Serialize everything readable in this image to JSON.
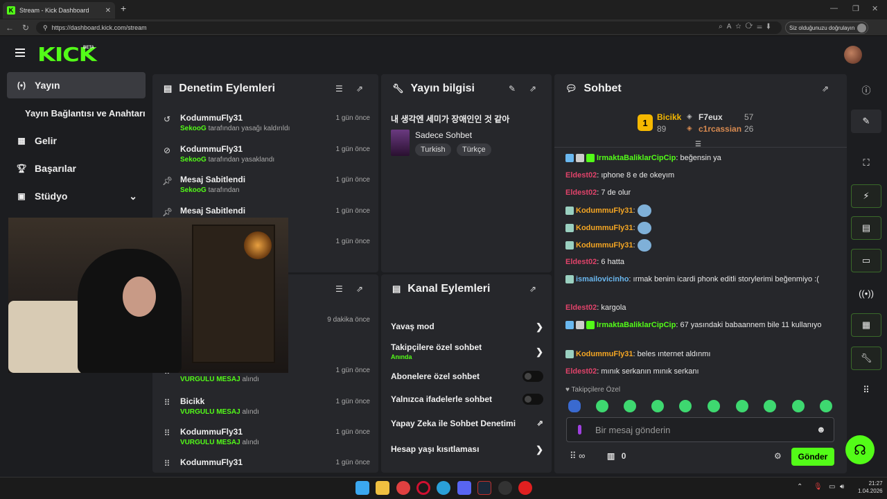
{
  "browser": {
    "tab_title": "Stream - Kick Dashboard",
    "url": "https://dashboard.kick.com/stream",
    "verify_label": "Siz olduğunuzu doğrulayın"
  },
  "app": {
    "logo": "KICK",
    "beta": "BETA"
  },
  "sidebar": {
    "items": [
      {
        "label": "Yayın",
        "icon": "broadcast-icon"
      },
      {
        "label": "Yayın Bağlantısı ve Anahtarı"
      },
      {
        "label": "Gelir",
        "icon": "revenue-icon"
      },
      {
        "label": "Başarılar",
        "icon": "trophy-icon"
      },
      {
        "label": "Stüdyo",
        "icon": "studio-icon"
      }
    ]
  },
  "moderation": {
    "title": "Denetim Eylemleri",
    "actions": [
      {
        "title": "KodummuFly31",
        "user": "SekooG",
        "desc": "tarafından yasağı kaldırıldı",
        "time": "1 gün önce",
        "icon": "unban-icon"
      },
      {
        "title": "KodummuFly31",
        "user": "SekooG",
        "desc": "tarafından yasaklandı",
        "time": "1 gün önce",
        "icon": "ban-icon"
      },
      {
        "title": "Mesaj Sabitlendi",
        "user": "SekooG",
        "desc": "tarafından",
        "time": "1 gün önce",
        "icon": "pin-icon"
      },
      {
        "title": "Mesaj Sabitlendi",
        "user": "",
        "desc": "",
        "time": "1 gün önce",
        "icon": "pin-icon"
      },
      {
        "title": "",
        "user": "",
        "desc": "",
        "time": "1 gün önce",
        "icon": ""
      }
    ]
  },
  "activity": {
    "items": [
      {
        "title": "",
        "user": "",
        "desc": "",
        "time": "9 dakika önce"
      },
      {
        "title": "",
        "user": "VURGULU MESAJ",
        "desc": "alındı",
        "time": "1 gün önce"
      },
      {
        "title": "Bicikk",
        "user": "VURGULU MESAJ",
        "desc": "alındı",
        "time": "1 gün önce"
      },
      {
        "title": "KodummuFly31",
        "user": "VURGULU MESAJ",
        "desc": "alındı",
        "time": "1 gün önce"
      },
      {
        "title": "KodummuFly31",
        "user": "",
        "desc": "",
        "time": "1 gün önce"
      }
    ]
  },
  "stream_info": {
    "title": "Yayın bilgisi",
    "stream_title": "내 생각엔 세미가 장애인인 것 같아",
    "category": "Sadece Sohbet",
    "tags": [
      "Turkish",
      "Türkçe"
    ]
  },
  "channel_actions": {
    "title": "Kanal Eylemleri",
    "items": [
      {
        "label": "Yavaş mod",
        "type": "chevron"
      },
      {
        "label": "Takipçilere özel sohbet",
        "sub": "Anında",
        "type": "chevron"
      },
      {
        "label": "Abonelere özel sohbet",
        "type": "toggle",
        "value": "off"
      },
      {
        "label": "Yalnızca ifadelerle sohbet",
        "type": "toggle",
        "value": "off"
      },
      {
        "label": "Yapay Zeka ile Sohbet Denetimi",
        "type": "external"
      },
      {
        "label": "Hesap yaşı kısıtlaması",
        "type": "chevron"
      }
    ]
  },
  "chat": {
    "title": "Sohbet",
    "leaderboard": [
      {
        "rank": "1",
        "name": "Bicikk",
        "value": "89"
      },
      {
        "rank": "2",
        "name": "F7eux",
        "value": "57"
      },
      {
        "rank": "3",
        "name": "c1rcassian",
        "value": "26"
      }
    ],
    "messages": [
      {
        "user": "IrmaktaBaliklarCipCip",
        "color": "#53fc18",
        "text": "beğensin ya"
      },
      {
        "user": "Eldest02",
        "color": "#e0436a",
        "text": "ıphone 8 e de okeyım"
      },
      {
        "user": "Eldest02",
        "color": "#e0436a",
        "text": "7 de olur"
      },
      {
        "user": "KodummuFly31",
        "color": "#f5a623",
        "text": ""
      },
      {
        "user": "KodummuFly31",
        "color": "#f5a623",
        "text": ""
      },
      {
        "user": "KodummuFly31",
        "color": "#f5a623",
        "text": ""
      },
      {
        "user": "Eldest02",
        "color": "#e0436a",
        "text": "6 hatta"
      },
      {
        "user": "ismailovicinho",
        "color": "#6ab8f0",
        "text": "ırmak benim icardi phonk editli storylerimi beğenmiyo :("
      },
      {
        "user": "Eldest02",
        "color": "#e0436a",
        "text": "kargola"
      },
      {
        "user": "IrmaktaBaliklarCipCip",
        "color": "#53fc18",
        "text": "67 yasındaki babaannem bile 11 kullanıyo"
      },
      {
        "user": "KodummuFly31",
        "color": "#f5a623",
        "text": "beles ınternet aldınmı"
      },
      {
        "user": "Eldest02",
        "color": "#e0436a",
        "text": "mınık serkanın mınık serkanı"
      }
    ],
    "followers_only": "Takipçilere Özel",
    "input_placeholder": "Bir mesaj gönderin",
    "points": "∞",
    "gifts": "0",
    "send_label": "Gönder"
  },
  "taskbar": {
    "time": "21:27",
    "date": "1.04.2026"
  },
  "colors": {
    "accent": "#53fc18",
    "panel": "#26272b",
    "background": "#1c1d20"
  }
}
